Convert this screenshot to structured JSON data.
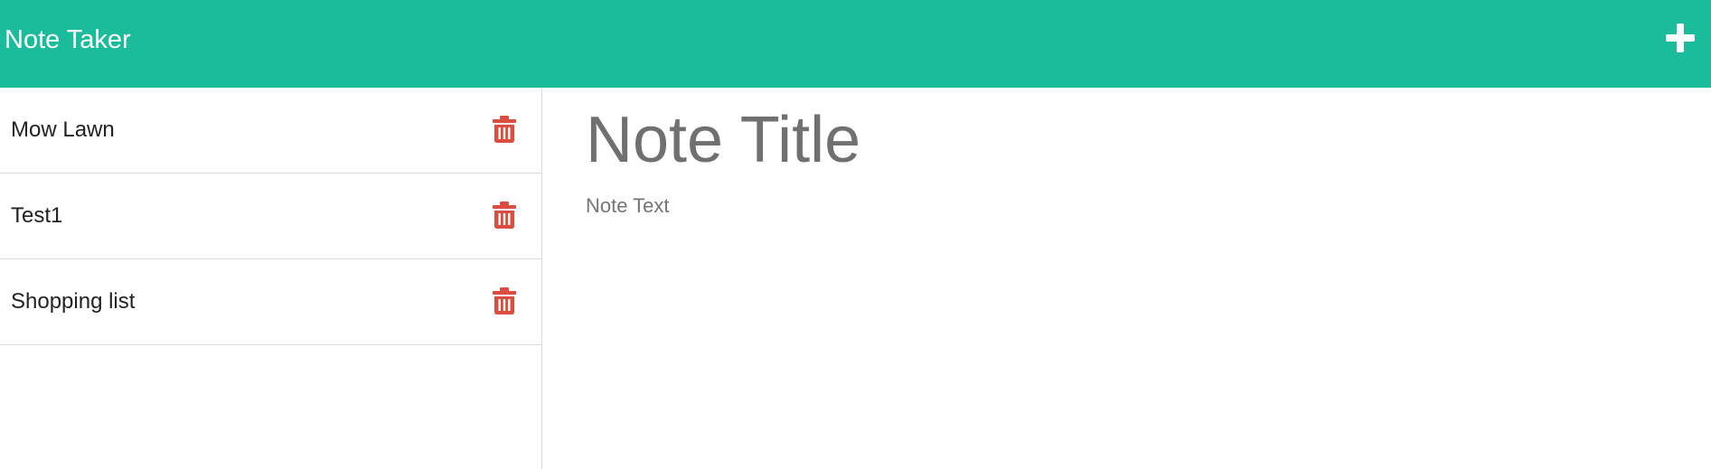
{
  "header": {
    "brand": "Note Taker",
    "new_note_icon": "plus-icon",
    "background_color": "#1abc9c"
  },
  "sidebar": {
    "notes": [
      {
        "title": "Mow Lawn",
        "delete_icon": "trash-icon"
      },
      {
        "title": "Test1",
        "delete_icon": "trash-icon"
      },
      {
        "title": "Shopping list",
        "delete_icon": "trash-icon"
      }
    ],
    "delete_icon_color": "#dc4c3f"
  },
  "editor": {
    "title_placeholder": "Note Title",
    "text_placeholder": "Note Text"
  }
}
